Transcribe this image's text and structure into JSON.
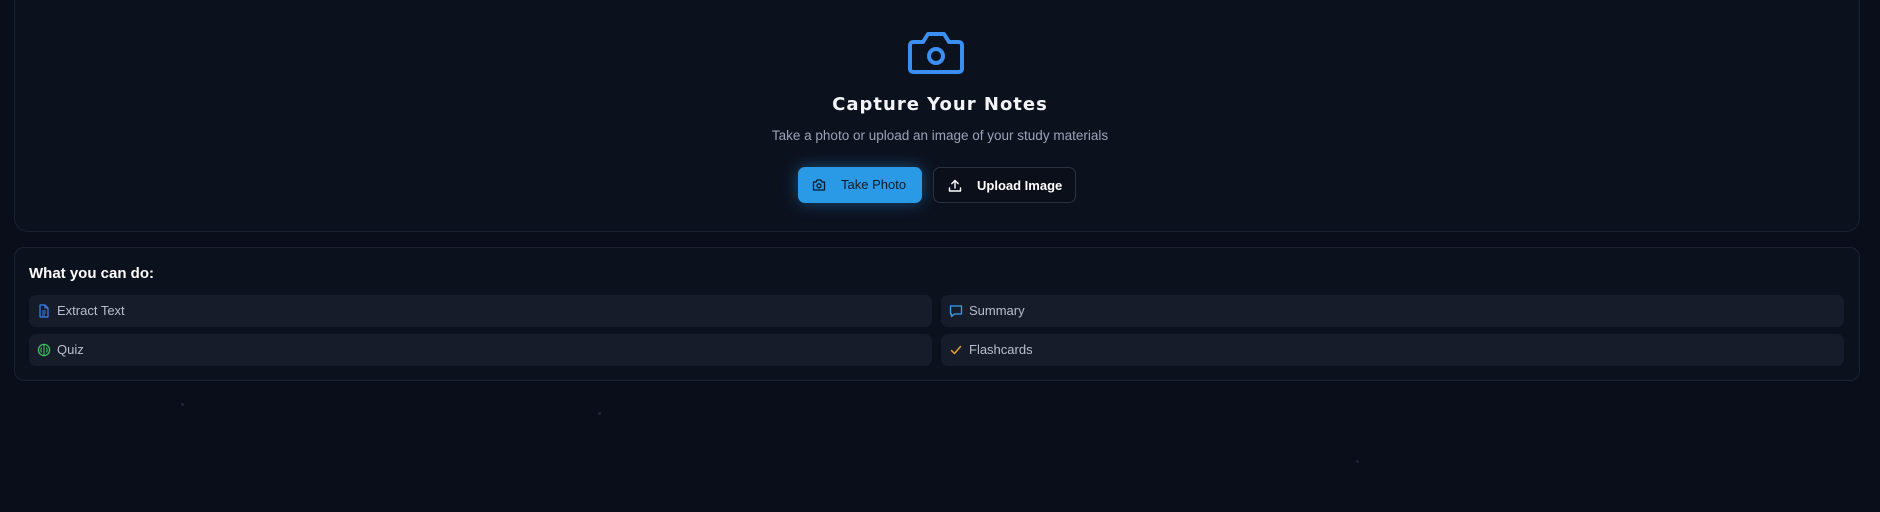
{
  "capture": {
    "icon": "camera-icon",
    "title": "Capture Your Notes",
    "subtitle": "Take a photo or upload an image of your study materials",
    "take_photo_label": "Take Photo",
    "upload_image_label": "Upload Image"
  },
  "features": {
    "title": "What you can do:",
    "items": [
      {
        "label": "Extract Text",
        "icon": "document-icon",
        "color": "#3b82f6"
      },
      {
        "label": "Summary",
        "icon": "chat-bubble-icon",
        "color": "#3aa0f0"
      },
      {
        "label": "Quiz",
        "icon": "brain-icon",
        "color": "#3fbf60"
      },
      {
        "label": "Flashcards",
        "icon": "check-icon",
        "color": "#e0a030"
      }
    ]
  },
  "colors": {
    "background": "#0a0e1a",
    "card": "#0c111e",
    "accent": "#2a9ae6"
  }
}
